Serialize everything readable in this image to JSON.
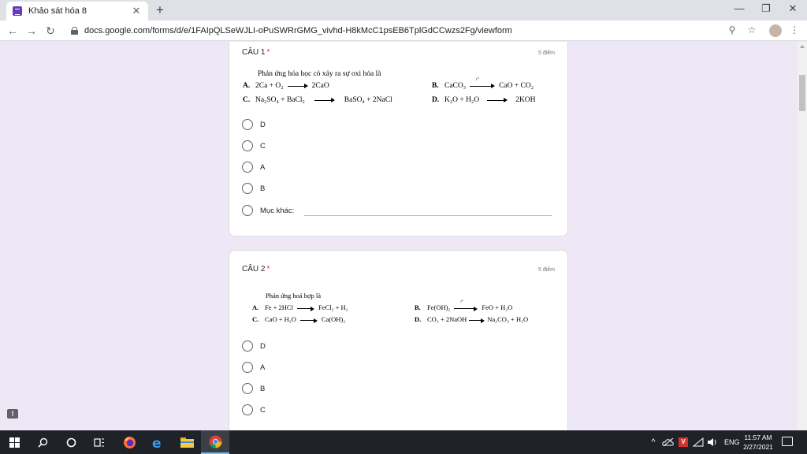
{
  "browser": {
    "tab_title": "Khảo sát hóa 8",
    "tab_close": "✕",
    "new_tab": "+",
    "url": "docs.google.com/forms/d/e/1FAIpQLSeWJLI-oPuSWRrGMG_vivhd-H8kMcC1psEB6TplGdCCwzs2Fg/viewform",
    "minimize": "—",
    "restore": "❐",
    "close": "✕",
    "back": "←",
    "forward": "→",
    "reload": "↻",
    "zoom_icon": "⚲",
    "star_icon": "☆",
    "menu_icon": "⋮"
  },
  "questions": [
    {
      "title": "CÂU 1",
      "required_mark": "*",
      "points": "5 điểm",
      "image": {
        "intro": "Phản ứng hóa học có xảy ra sự oxi hóa là",
        "options": [
          {
            "letter": "A.",
            "lhs": "2Ca + O₂",
            "rhs": "2CaO",
            "heat": ""
          },
          {
            "letter": "B.",
            "lhs": "CaCO₃",
            "rhs": "CaO + CO₂",
            "heat": "t°"
          },
          {
            "letter": "C.",
            "lhs": "Na₂SO₄ + BaCl₂",
            "rhs": "BaSO₄ + 2NaCl",
            "heat": ""
          },
          {
            "letter": "D.",
            "lhs": "K₂O + H₂O",
            "rhs": "2KOH",
            "heat": ""
          }
        ]
      },
      "choices": [
        "D",
        "C",
        "A",
        "B"
      ],
      "other_label": "Mục khác:"
    },
    {
      "title": "CÂU 2",
      "required_mark": "*",
      "points": "5 điểm",
      "image": {
        "intro": "Phản ứng hoá hợp là",
        "options": [
          {
            "letter": "A.",
            "lhs": "Fe  +  2HCl",
            "rhs": "FeCl₂  +  H₂",
            "heat": ""
          },
          {
            "letter": "B.",
            "lhs": "Fe(OH)₂",
            "rhs": "FeO  +  H₂O",
            "heat": "t°"
          },
          {
            "letter": "C.",
            "lhs": "CaO  +  H₂O",
            "rhs": "Ca(OH)₂",
            "heat": ""
          },
          {
            "letter": "D.",
            "lhs": "CO₂ + 2NaOH",
            "rhs": "Na₂CO₃ + H₂O",
            "heat": ""
          }
        ]
      },
      "choices": [
        "D",
        "A",
        "B",
        "C"
      ]
    }
  ],
  "feedback_icon": "!",
  "taskbar": {
    "language": "ENG",
    "time": "11:57 AM",
    "date": "2/27/2021"
  },
  "colors": {
    "form_background": "#ede7f6",
    "required": "#d93025",
    "taskbar": "#1f2229"
  }
}
